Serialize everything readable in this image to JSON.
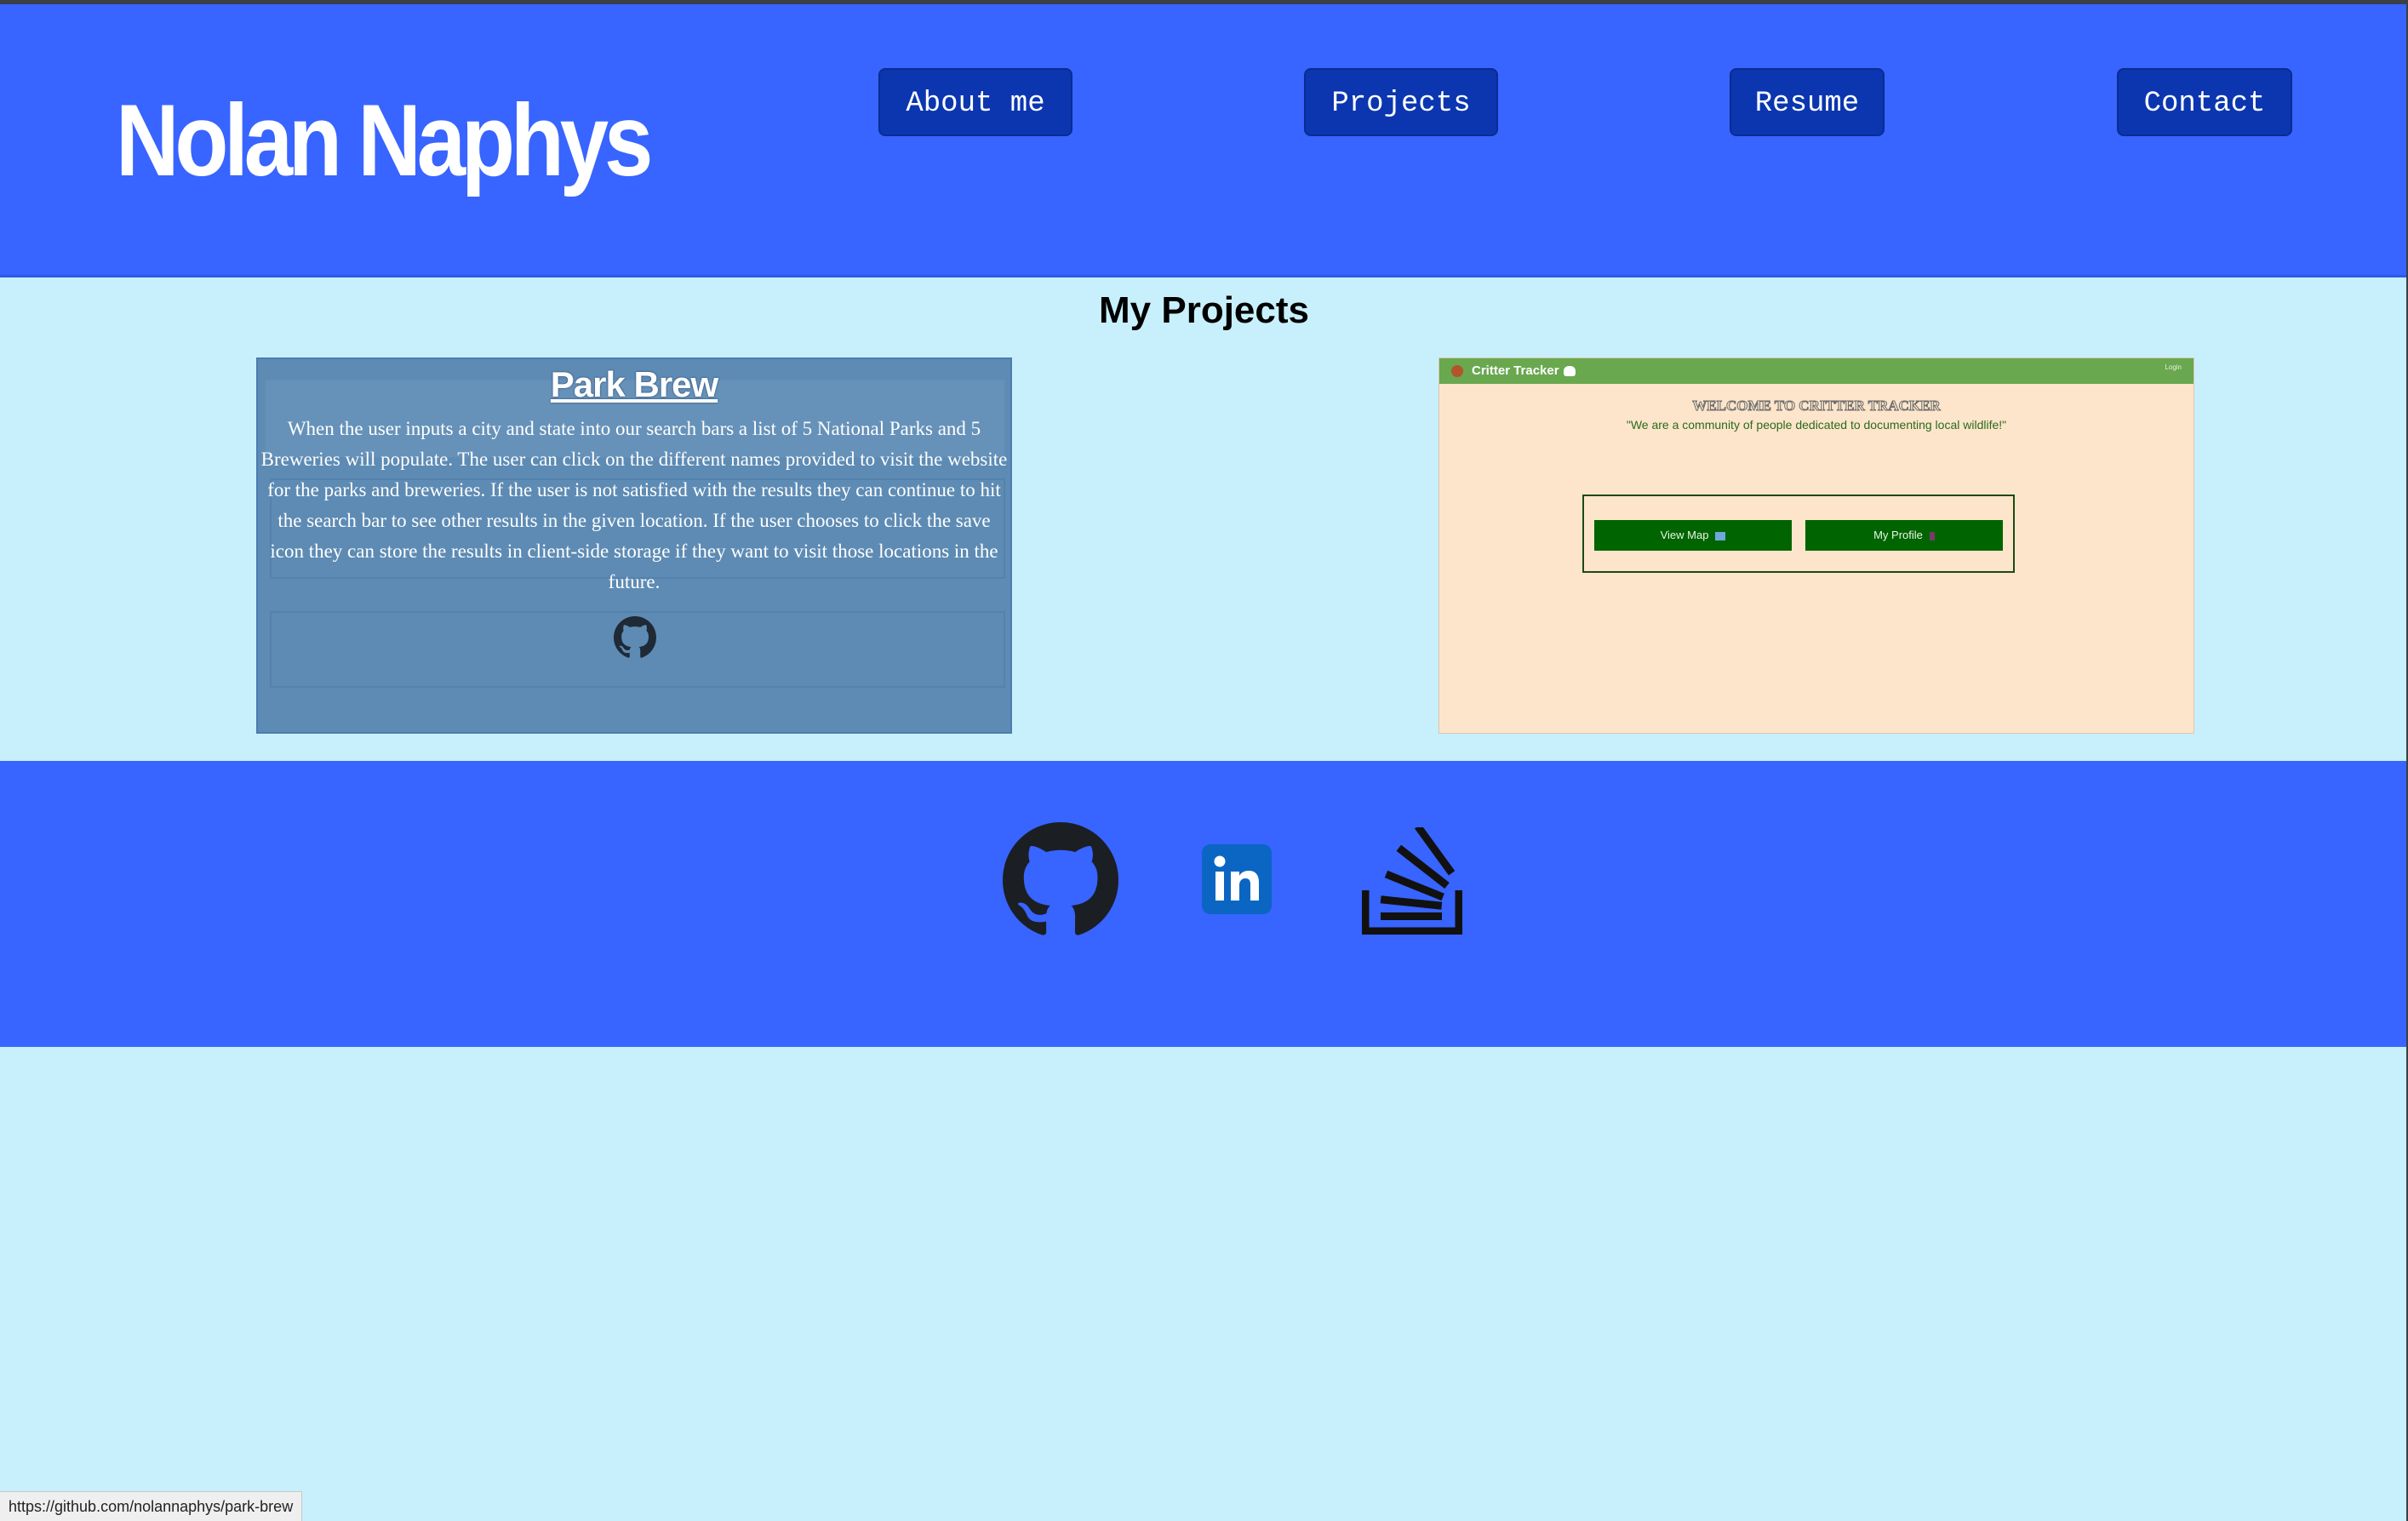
{
  "header": {
    "brand": "Nolan Naphys",
    "nav": [
      "About me",
      "Projects",
      "Resume",
      "Contact"
    ]
  },
  "projects": {
    "title": "My Projects",
    "park_brew": {
      "title": "Park Brew",
      "description": "When the user inputs a city and state into our search bars a list of 5 National Parks and 5 Breweries will populate. The user can click on the different names provided to visit the website for the parks and breweries. If the user is not satisfied with the results they can continue to hit the search bar to see other results in the given location. If the user chooses to click the save icon they can store the results in client-side storage if they want to visit those locations in the future.",
      "link_icon": "github-icon"
    },
    "critter_tracker": {
      "app_name": "Critter Tracker",
      "login": "Login",
      "welcome": "WELCOME TO CRITTER TRACKER",
      "tagline": "\"We are a community of people dedicated to documenting local wildlife!\"",
      "view_map": "View Map",
      "my_profile": "My Profile"
    }
  },
  "footer": {
    "links": [
      "github-icon",
      "linkedin-icon",
      "stackoverflow-icon"
    ]
  },
  "status_bar": "https://github.com/nolannaphys/park-brew",
  "colors": {
    "header_bg": "#3864ff",
    "page_bg": "#c8f0fc",
    "nav_btn": "#0b36b0",
    "linkedin": "#0a66c2",
    "critter_green": "#006400"
  }
}
